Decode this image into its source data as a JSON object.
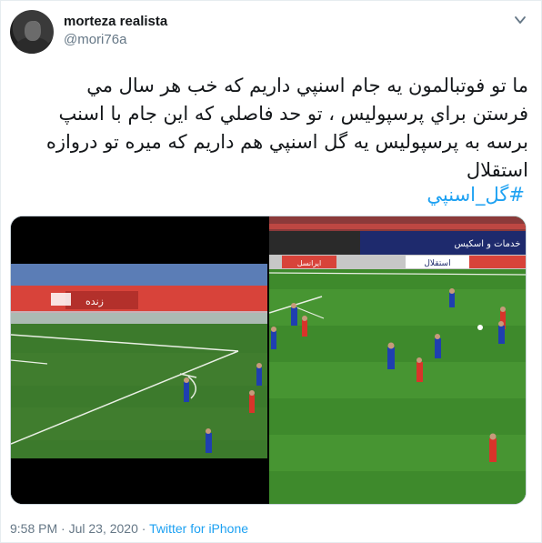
{
  "user": {
    "display_name": "morteza realista",
    "handle": "@mori76a"
  },
  "tweet": {
    "lines": [
      "ما تو فوتبالمون يه جام اسنپي داريم كه خب هر سال مي",
      "فرستن براي پرسپوليس ، تو حد فاصلي كه اين جام با اسنپ",
      "برسه به پرسپوليس يه گل اسنپي هم داريم كه ميره تو دروازه",
      "استقلال"
    ],
    "hashtag": "#گل_اسنپي"
  },
  "media": {
    "left": {
      "watermark": "زنده"
    },
    "right": {
      "boards": [
        "خدمات و اسکیس",
        "استقلال",
        "ایرانسل"
      ]
    }
  },
  "footer": {
    "time": "9:58 PM",
    "separator": "·",
    "date": "Jul 23, 2020",
    "source": "Twitter for iPhone"
  },
  "icons": {
    "menu": "chevron-down-icon"
  },
  "colors": {
    "link": "#1da1f2",
    "secondary_text": "#657786",
    "pitch_light": "#4c9a35",
    "pitch_dark": "#3e8a2c",
    "team_blue": "#1f3fb0",
    "team_red": "#d8342a"
  }
}
